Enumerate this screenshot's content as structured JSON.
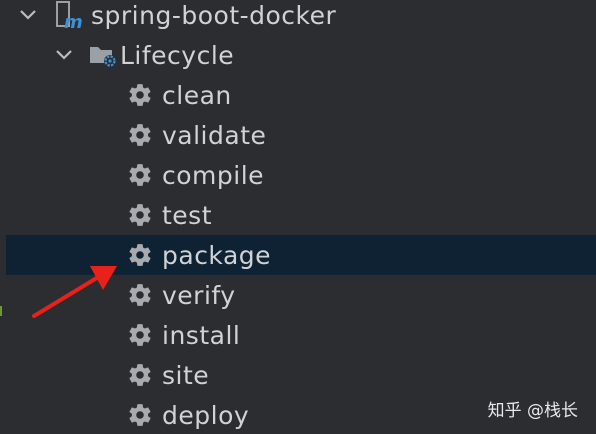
{
  "tree": {
    "project": {
      "label": "spring-boot-docker",
      "icon": "maven-module-icon",
      "expanded": true
    },
    "group": {
      "label": "Lifecycle",
      "icon": "lifecycle-folder-icon",
      "expanded": true
    },
    "items": [
      {
        "label": "clean",
        "icon": "gear-icon",
        "selected": false
      },
      {
        "label": "validate",
        "icon": "gear-icon",
        "selected": false
      },
      {
        "label": "compile",
        "icon": "gear-icon",
        "selected": false
      },
      {
        "label": "test",
        "icon": "gear-icon",
        "selected": false
      },
      {
        "label": "package",
        "icon": "gear-icon",
        "selected": true
      },
      {
        "label": "verify",
        "icon": "gear-icon",
        "selected": false
      },
      {
        "label": "install",
        "icon": "gear-icon",
        "selected": false
      },
      {
        "label": "site",
        "icon": "gear-icon",
        "selected": false
      },
      {
        "label": "deploy",
        "icon": "gear-icon",
        "selected": false
      }
    ]
  },
  "watermark": {
    "text": "知乎 @栈长"
  },
  "colors": {
    "background": "#2b2d30",
    "selection": "#0f2233",
    "text": "#cfd2d6",
    "arrow": "#e8221b",
    "folder_badge": "#3d8fd6"
  }
}
